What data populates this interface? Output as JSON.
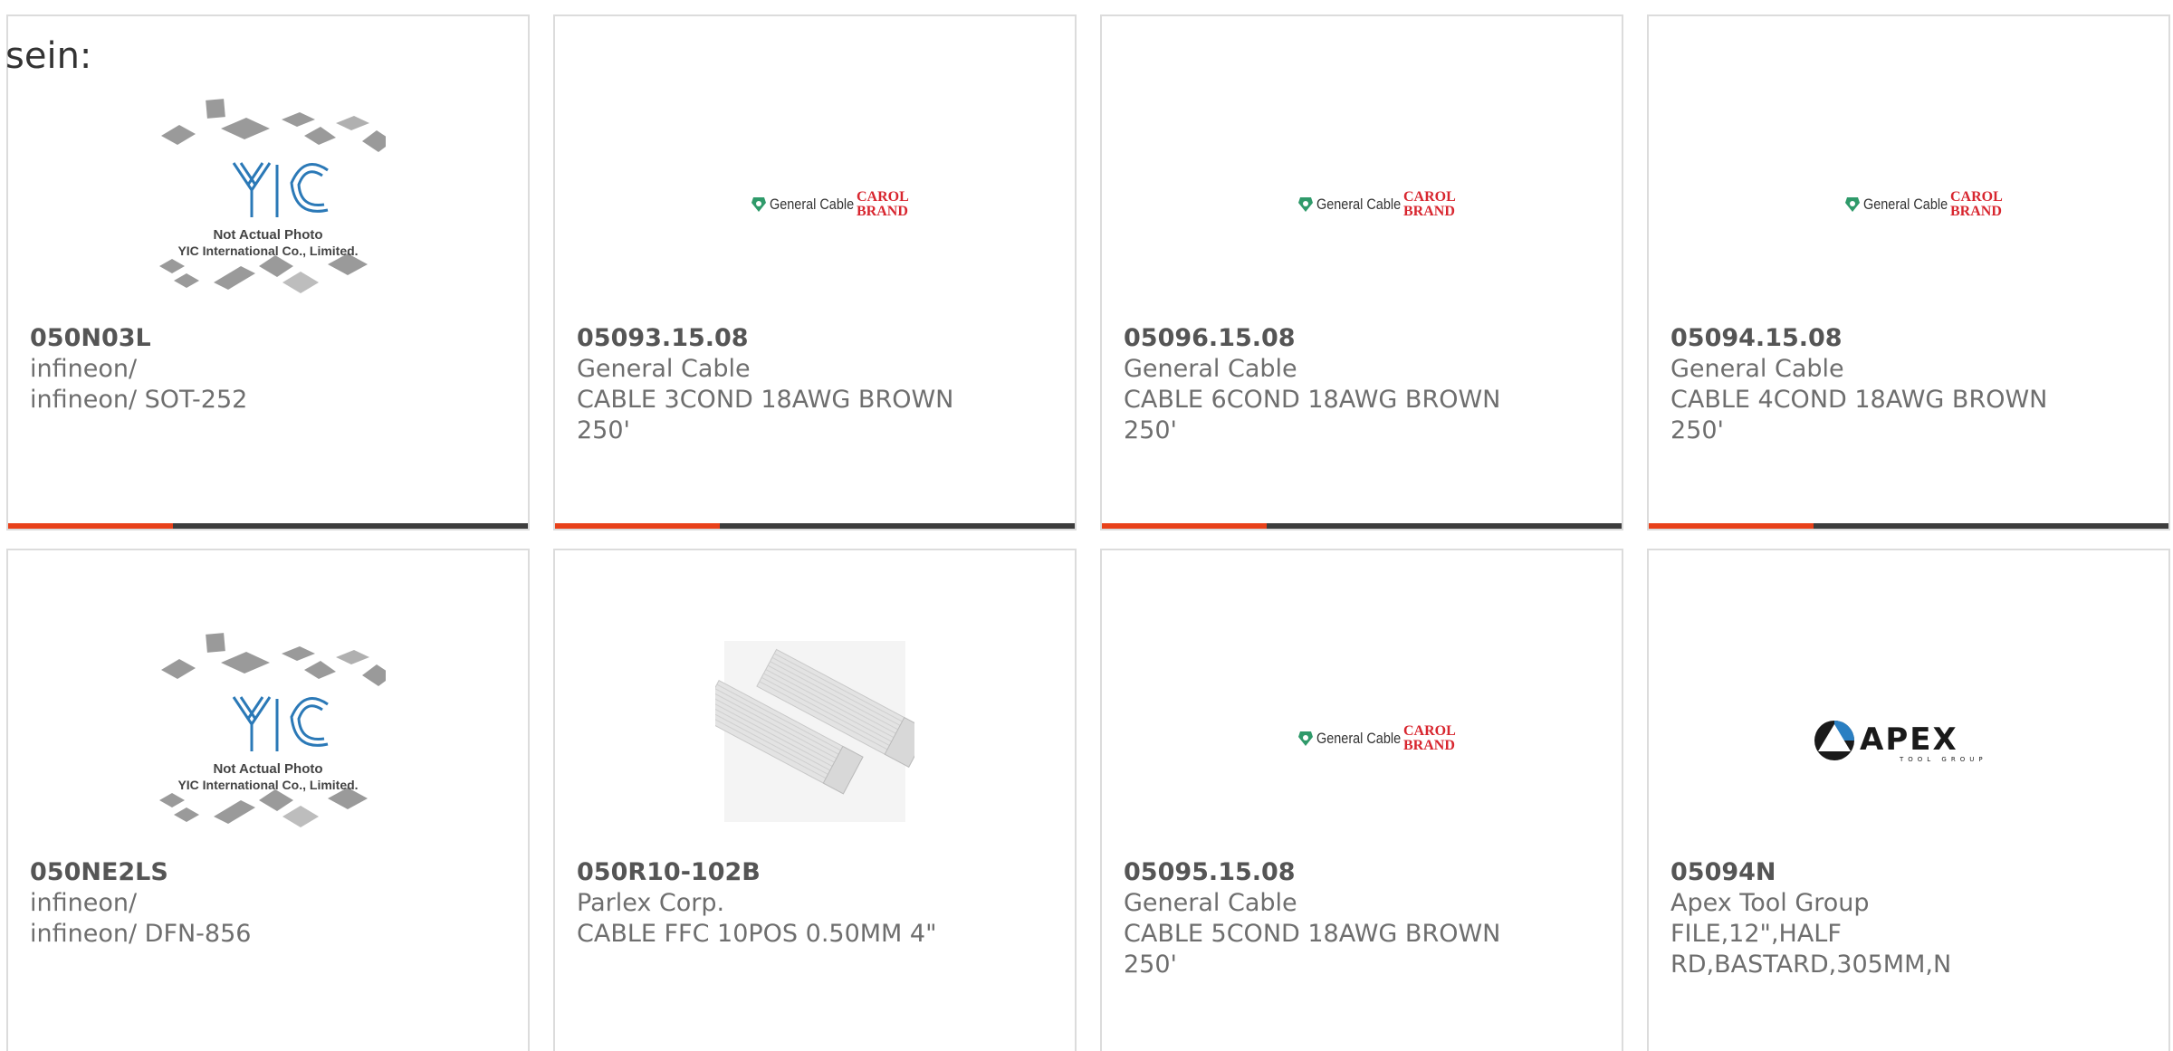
{
  "heading": "sein:",
  "colors": {
    "accent": "#e8411a",
    "bar_dark": "#3d3d3d",
    "border": "#dcdcdc"
  },
  "products": [
    {
      "part_number": "050N03L",
      "manufacturer": "infineon/",
      "description": "infineon/ SOT-252",
      "image": "yic-placeholder",
      "image_text_1": "Not Actual Photo",
      "image_text_2": "YIC International Co., Limited."
    },
    {
      "part_number": "05093.15.08",
      "manufacturer": "General Cable",
      "description": "CABLE 3COND 18AWG BROWN 250'",
      "image": "general-cable-logo",
      "logo_text": "General Cable",
      "logo_brand_1": "CAROL",
      "logo_brand_2": "BRAND"
    },
    {
      "part_number": "05096.15.08",
      "manufacturer": "General Cable",
      "description": "CABLE 6COND 18AWG BROWN 250'",
      "image": "general-cable-logo",
      "logo_text": "General Cable",
      "logo_brand_1": "CAROL",
      "logo_brand_2": "BRAND"
    },
    {
      "part_number": "05094.15.08",
      "manufacturer": "General Cable",
      "description": "CABLE 4COND 18AWG BROWN 250'",
      "image": "general-cable-logo",
      "logo_text": "General Cable",
      "logo_brand_1": "CAROL",
      "logo_brand_2": "BRAND"
    },
    {
      "part_number": "050NE2LS",
      "manufacturer": "infineon/",
      "description": "infineon/ DFN-856",
      "image": "yic-placeholder",
      "image_text_1": "Not Actual Photo",
      "image_text_2": "YIC International Co., Limited."
    },
    {
      "part_number": "050R10-102B",
      "manufacturer": "Parlex Corp.",
      "description": "CABLE FFC 10POS 0.50MM 4\"",
      "image": "ffc-cable-photo"
    },
    {
      "part_number": "05095.15.08",
      "manufacturer": "General Cable",
      "description": "CABLE 5COND 18AWG BROWN 250'",
      "image": "general-cable-logo",
      "logo_text": "General Cable",
      "logo_brand_1": "CAROL",
      "logo_brand_2": "BRAND"
    },
    {
      "part_number": "05094N",
      "manufacturer": "Apex Tool Group",
      "description": "FILE,12\",HALF RD,BASTARD,305MM,N",
      "image": "apex-logo",
      "logo_text": "APEX",
      "logo_sub": "TOOL GROUP"
    }
  ]
}
